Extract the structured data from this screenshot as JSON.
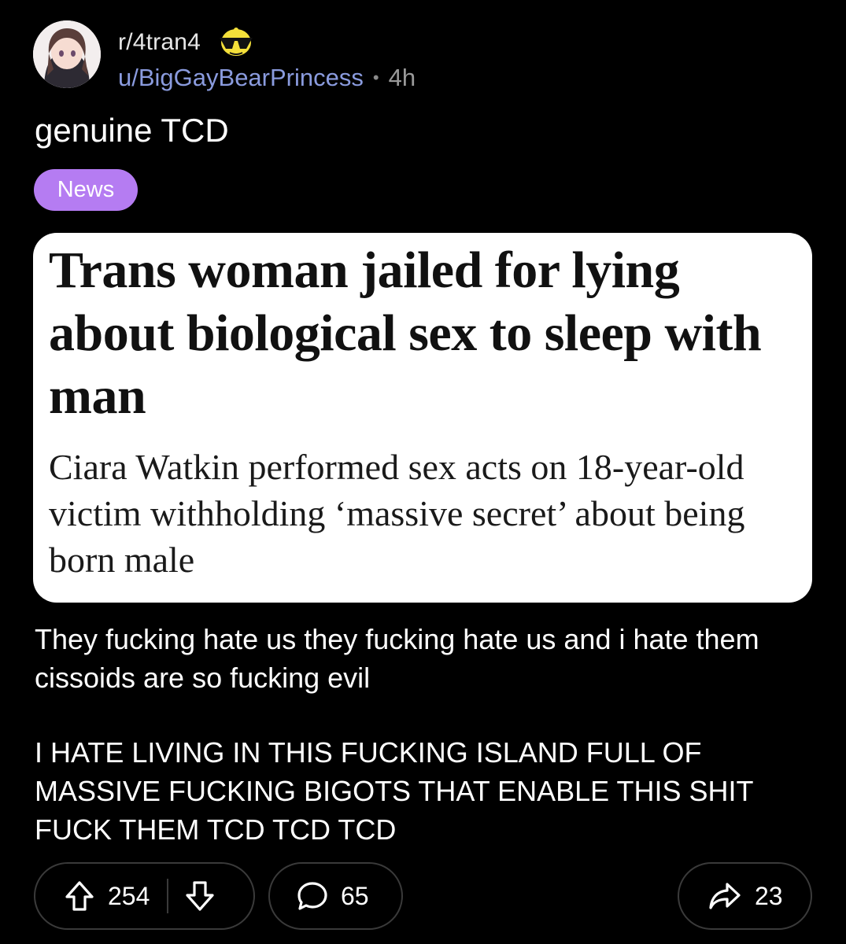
{
  "post": {
    "subreddit": "r/4tran4",
    "username": "u/BigGayBearPrincess",
    "separator": "•",
    "age": "4h",
    "title": "genuine TCD",
    "flair": "News",
    "flair_color": "#b57cf2",
    "article": {
      "headline": "Trans woman jailed for lying about biological sex to sleep with man",
      "standfirst": "Ciara Watkin performed sex acts on 18-year-old victim withholding ‘massive secret’ about being born male"
    },
    "body": [
      "They fucking hate us they fucking hate us and i hate them cissoids are so fucking evil",
      "I HATE LIVING IN THIS FUCKING ISLAND FULL OF MASSIVE FUCKING BIGOTS THAT ENABLE THIS SHIT FUCK THEM TCD TCD TCD"
    ]
  },
  "actions": {
    "upvotes": "254",
    "comments": "65",
    "shares": "23",
    "icons": [
      "upvote-icon",
      "downvote-icon",
      "comment-icon",
      "share-icon"
    ]
  }
}
